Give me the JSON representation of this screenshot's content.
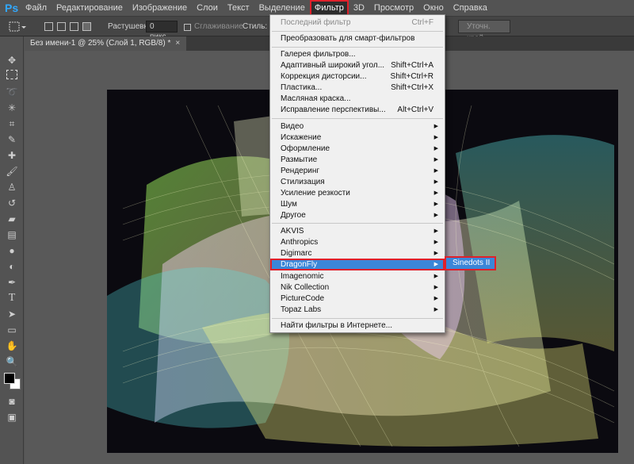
{
  "app": {
    "logo": "Ps"
  },
  "menubar": {
    "items": [
      "Файл",
      "Редактирование",
      "Изображение",
      "Слои",
      "Текст",
      "Выделение",
      "Фильтр",
      "3D",
      "Просмотр",
      "Окно",
      "Справка"
    ],
    "active": "Фильтр"
  },
  "options": {
    "feather_label": "Растушевка:",
    "feather_value": "0 пикс.",
    "antialias_label": "Сглаживание",
    "style_label": "Стиль:",
    "refine_edge": "Уточн. край..."
  },
  "document": {
    "tab_title": "Без имени-1 @ 25% (Слой 1, RGB/8) *",
    "close": "×"
  },
  "filter_menu": {
    "last_filter": {
      "label": "Последний фильтр",
      "shortcut": "Ctrl+F"
    },
    "convert": "Преобразовать для смарт-фильтров",
    "group1": [
      {
        "label": "Галерея фильтров...",
        "shortcut": ""
      },
      {
        "label": "Адаптивный широкий угол...",
        "shortcut": "Shift+Ctrl+A"
      },
      {
        "label": "Коррекция дисторсии...",
        "shortcut": "Shift+Ctrl+R"
      },
      {
        "label": "Пластика...",
        "shortcut": "Shift+Ctrl+X"
      },
      {
        "label": "Масляная краска...",
        "shortcut": ""
      },
      {
        "label": "Исправление перспективы...",
        "shortcut": "Alt+Ctrl+V"
      }
    ],
    "group2": [
      "Видео",
      "Искажение",
      "Оформление",
      "Размытие",
      "Рендеринг",
      "Стилизация",
      "Усиление резкости",
      "Шум",
      "Другое"
    ],
    "group3": [
      "AKVIS",
      "Anthropics",
      "Digimarc",
      "DragonFly",
      "Imagenomic",
      "Nik Collection",
      "PictureCode",
      "Topaz Labs"
    ],
    "highlighted": "DragonFly",
    "browse": "Найти фильтры в Интернете..."
  },
  "submenu": {
    "item": "Sinedots II"
  },
  "colors": {
    "accent": "#3b86d8",
    "highlight_border": "#e0202a",
    "canvas_bg": "#0b0a10"
  }
}
